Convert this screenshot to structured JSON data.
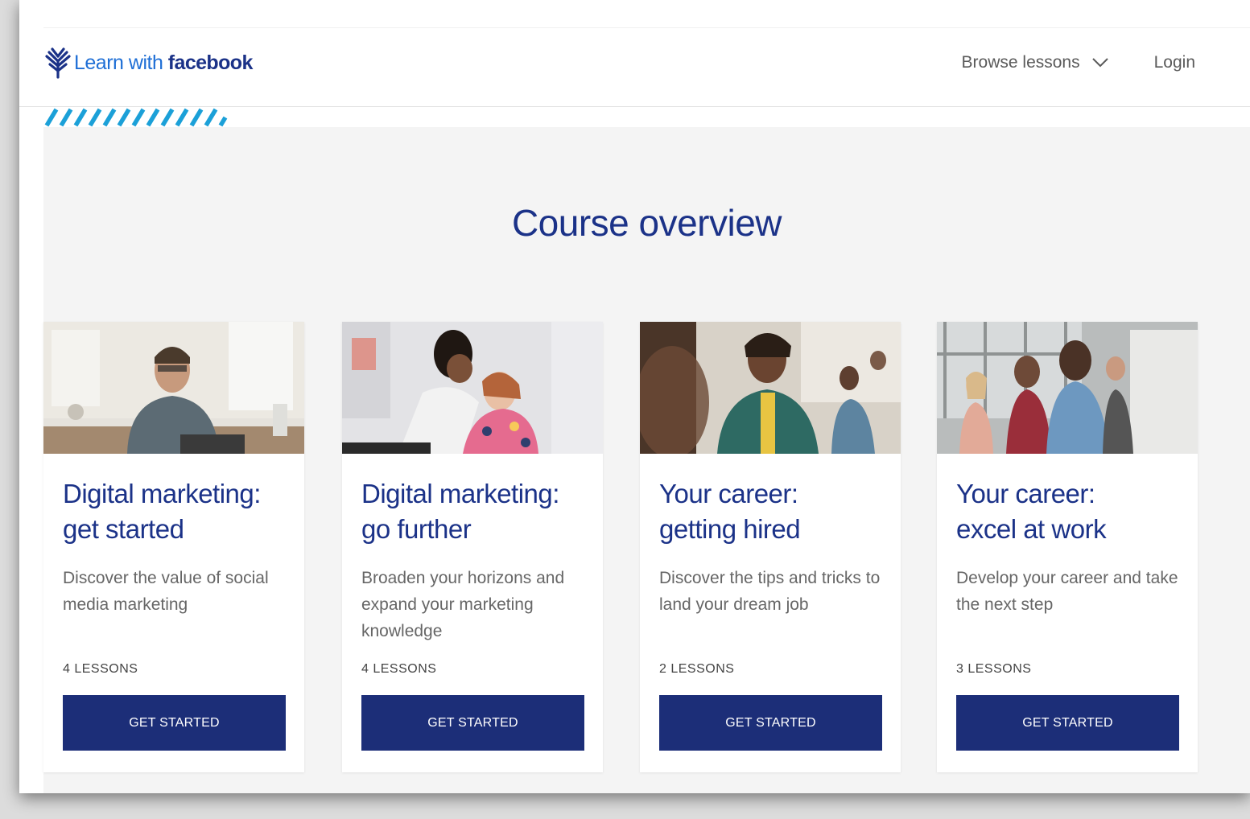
{
  "header": {
    "logo": {
      "text_light": "Learn with ",
      "text_bold": "facebook",
      "icon": "fern-leaf-icon",
      "colors": {
        "light": "#1f6fd6",
        "bold": "#1b3288"
      }
    },
    "nav": {
      "browse_label": "Browse lessons",
      "browse_icon": "chevron-down-icon",
      "login_label": "Login"
    }
  },
  "main": {
    "title": "Course overview",
    "cards": [
      {
        "title_line1": "Digital marketing:",
        "title_line2": "get started",
        "description": "Discover the value of social media marketing",
        "lessons": "4 LESSONS",
        "button": "GET STARTED",
        "image": "photo-man-with-laptop-in-kitchen"
      },
      {
        "title_line1": "Digital marketing:",
        "title_line2": "go further",
        "description": "Broaden your horizons and expand your marketing knowledge",
        "lessons": "4 LESSONS",
        "button": "GET STARTED",
        "image": "photo-two-women-working-together"
      },
      {
        "title_line1": "Your career:",
        "title_line2": "getting hired",
        "description": "Discover the tips and tricks to land your dream job",
        "lessons": "2 LESSONS",
        "button": "GET STARTED",
        "image": "photo-smiling-woman-in-office"
      },
      {
        "title_line1": "Your career:",
        "title_line2": "excel at work",
        "description": "Develop your career and take the next step",
        "lessons": "3 LESSONS",
        "button": "GET STARTED",
        "image": "photo-team-meeting-at-whiteboard"
      }
    ]
  },
  "colors": {
    "primary": "#1b3288",
    "button": "#1c2e78",
    "accent_stripe": "#1ba0d8",
    "section_bg": "#f4f4f4"
  }
}
